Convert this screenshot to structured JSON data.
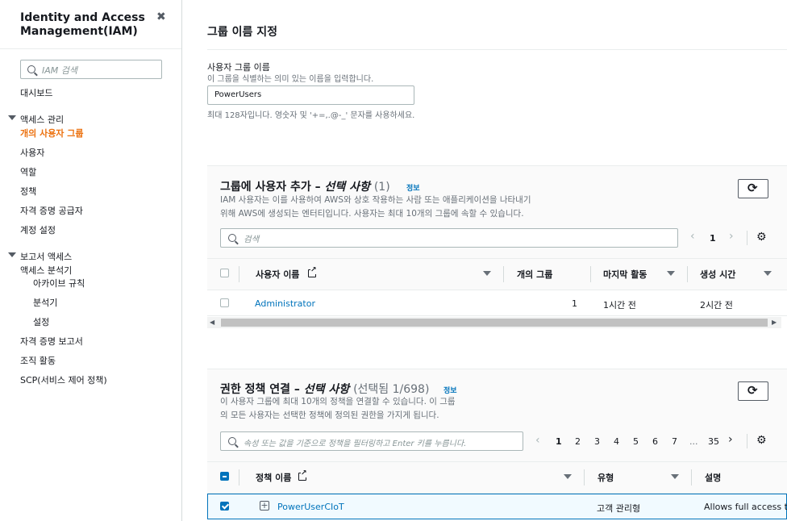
{
  "sidebar": {
    "title": "Identity and Access Management(IAM)",
    "search_placeholder": "IAM 검색",
    "dashboard": "대시보드",
    "access_mgmt": "액세스 관리",
    "user_groups": "개의 사용자 그룹",
    "users": "사용자",
    "roles": "역할",
    "policies": "정책",
    "identity_providers": "자격 증명 공급자",
    "account_settings": "계정 설정",
    "report_access": "보고서 액세스",
    "access_analyzer": "액세스 분석기",
    "archive_rules": "아카이브 규칙",
    "analyzer": "분석기",
    "settings": "설정",
    "credential_report": "자격 증명 보고서",
    "org_activity": "조직 활동",
    "scp": "SCP(서비스 제어 정책)"
  },
  "name_section": {
    "heading": "그룹 이름 지정",
    "label": "사용자 그룹 이름",
    "description": "이 그룹을 식별하는 의미 있는 이름을 입력합니다.",
    "value": "PowerUsers",
    "constraint": "최대 128자입니다. 영숫자 및 '+=,.@-_' 문자를 사용하세요."
  },
  "users_panel": {
    "title": "그룹에 사용자 추가 – ",
    "title_optional": "선택 사항",
    "count": "(1)",
    "info": "정보",
    "desc1": "IAM 사용자는 이를 사용하여 AWS와 상호 작용하는 사람 또는 애플리케이션을 나타내기",
    "desc2": "위해 AWS에 생성되는 엔터티입니다. 사용자는 최대 10개의 그룹에 속할 수 있습니다.",
    "search_placeholder": "검색",
    "page": "1",
    "columns": [
      "사용자 이름",
      "개의 그룹",
      "마지막 활동",
      "생성 시간"
    ],
    "rows": [
      {
        "name": "Administrator",
        "groups": "1",
        "last_activity": "1시간 전",
        "created": "2시간 전"
      }
    ]
  },
  "policy_panel": {
    "title": "권한 정책 연결 – ",
    "title_optional": "선택 사항",
    "count": "(선택됨 1/698)",
    "info": "정보",
    "desc1": "이 사용자 그룹에 최대 10개의 정책을 연결할 수 있습니다. 이 그룹",
    "desc2": "의 모든 사용자는 선택한 정책에 정의된 권한을 가지게 됩니다.",
    "search_placeholder": "속성 또는 값을 기준으로 정책을 필터링하고 Enter 키를 누릅니다.",
    "pages": [
      "1",
      "2",
      "3",
      "4",
      "5",
      "6",
      "7",
      "...",
      "35"
    ],
    "columns": [
      "정책 이름",
      "유형",
      "설명"
    ],
    "rows": [
      {
        "name": "PowerUserCIoT",
        "type": "고객 관리형",
        "description": "Allows full access to"
      }
    ]
  }
}
